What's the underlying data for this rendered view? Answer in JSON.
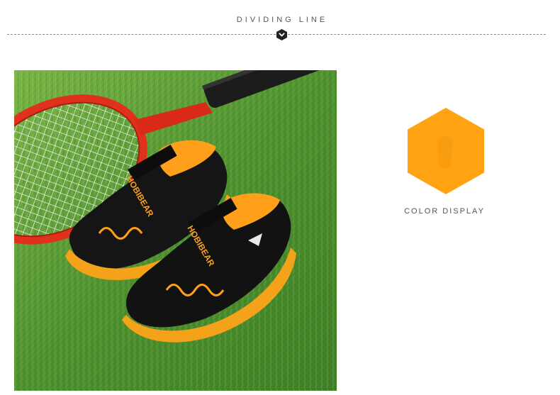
{
  "header": {
    "title": "DIVIDING LINE",
    "badge_icon": "chevron-down-badge-icon"
  },
  "product": {
    "image_alt": "Black and orange HOBIBEAR kids sneakers on grass next to a red tennis racket",
    "brand_text": "HOBIBEAR"
  },
  "color_display": {
    "label": "COLOR DISPLAY",
    "swatch_color": "#ffa312",
    "swatch_shape": "hexagon"
  },
  "colors": {
    "accent": "#ffa312",
    "badge": "#222222",
    "text": "#555555"
  }
}
